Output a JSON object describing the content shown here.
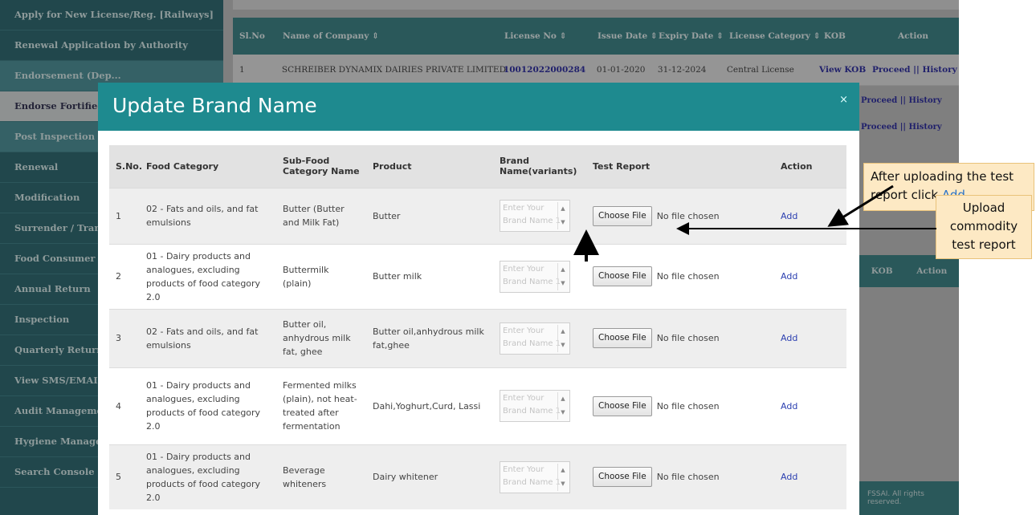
{
  "sidebar": {
    "items": [
      {
        "label": "Apply for New License/Reg. [Railways]"
      },
      {
        "label": "Renewal Application by Authority"
      },
      {
        "label": "Endorsement (Dep..."
      },
      {
        "label": "Endorse Fortified P..."
      },
      {
        "label": "Post Inspection Cl..."
      },
      {
        "label": "Renewal"
      },
      {
        "label": "Modification"
      },
      {
        "label": "Surrender / Transf..."
      },
      {
        "label": "Food Consumer Gr..."
      },
      {
        "label": "Annual Return"
      },
      {
        "label": "Inspection"
      },
      {
        "label": "Quarterly Return fo..."
      },
      {
        "label": "View SMS/EMAIL H..."
      },
      {
        "label": "Audit Manageme..."
      },
      {
        "label": "Hygiene Manage..."
      },
      {
        "label": "Search Console - M..."
      }
    ]
  },
  "background_table": {
    "headers": [
      "Sl.No",
      "Name of Company ⇕",
      "License No ⇕",
      "Issue Date ⇕",
      "Expiry Date ⇕",
      "License Category ⇕",
      "KOB",
      "Action"
    ],
    "row": {
      "sno": "1",
      "company": "SCHREIBER DYNAMIX DAIRIES PRIVATE LIMITED",
      "license": "10012022000284",
      "issue": "01-01-2020",
      "expiry": "31-12-2024",
      "category": "Central License",
      "kob": "View KOB",
      "action": "Proceed || History"
    },
    "row2_action": "Proceed || History",
    "row3_action": "Proceed || History",
    "second_headers": [
      "KOB",
      "Action"
    ],
    "footer": "FSSAI. All rights reserved."
  },
  "modal": {
    "title": "Update Brand Name",
    "close": "×",
    "headers": {
      "sno": "S.No.",
      "food_category": "Food Category",
      "sub_food": "Sub-Food Category Name",
      "product": "Product",
      "brand": "Brand Name(variants)",
      "test_report": "Test Report",
      "action": "Action"
    },
    "placeholder": "Enter Your Brand Name 1",
    "choose_file": "Choose File",
    "no_file": "No file chosen",
    "add": "Add",
    "rows": [
      {
        "sno": "1",
        "category": "02 - Fats and oils, and fat emulsions",
        "sub": "Butter (Butter and Milk Fat)",
        "product": "Butter"
      },
      {
        "sno": "2",
        "category": "01 - Dairy products and analogues, excluding products of food category 2.0",
        "sub": "Buttermilk (plain)",
        "product": "Butter milk"
      },
      {
        "sno": "3",
        "category": "02 - Fats and oils, and fat emulsions",
        "sub": "Butter oil, anhydrous milk fat, ghee",
        "product": "Butter oil,anhydrous milk fat,ghee"
      },
      {
        "sno": "4",
        "category": "01 - Dairy products and analogues, excluding products of food category 2.0",
        "sub": "Fermented milks (plain), not heat-treated after fermentation",
        "product": "Dahi,Yoghurt,Curd, Lassi"
      },
      {
        "sno": "5",
        "category": "01 - Dairy products and analogues, excluding products of food category 2.0",
        "sub": "Beverage whiteners",
        "product": "Dairy whitener"
      }
    ]
  },
  "callouts": {
    "upload_add_prefix": "After uploading the test report click",
    "upload_add_link": "Add",
    "upload_report": "Upload commodity test report"
  }
}
